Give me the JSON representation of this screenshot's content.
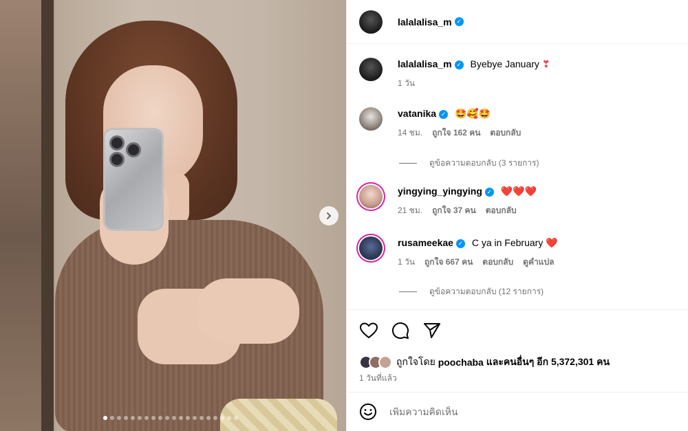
{
  "post": {
    "author": "lalalalisa_m",
    "caption": "Byebye January",
    "caption_emoji": "❣",
    "caption_time": "1 วัน",
    "carousel": {
      "total_slides": 20,
      "active_index": 0
    }
  },
  "comments": [
    {
      "user": "vatanika",
      "text": "🤩🥰🤩",
      "time": "14 ชม.",
      "likes": "ถูกใจ 162 คน",
      "reply": "ตอบกลับ",
      "view_replies": "ดูข้อความตอบกลับ (3 รายการ)"
    },
    {
      "user": "yingying_yingying",
      "text": "❤️❤️❤️",
      "time": "21 ชม.",
      "likes": "ถูกใจ 37 คน",
      "reply": "ตอบกลับ"
    },
    {
      "user": "rusameekae",
      "text": "C ya in February",
      "emoji": "❤️",
      "time": "1 วัน",
      "likes": "ถูกใจ 667 คน",
      "reply": "ตอบกลับ",
      "translate": "ดูคำแปล",
      "view_replies": "ดูข้อความตอบกลับ (12 รายการ)"
    }
  ],
  "likes_summary": {
    "prefix": "ถูกใจโดย",
    "user": "poochaba",
    "suffix": "และคนอื่นๆ อีก 5,372,301 คน"
  },
  "post_time": "1 วันที่แล้ว",
  "add_comment": {
    "placeholder": "เพิ่มความคิดเห็น"
  },
  "colors": {
    "verified": "#0095f6",
    "heart": "#ed4956",
    "muted": "#737373"
  }
}
